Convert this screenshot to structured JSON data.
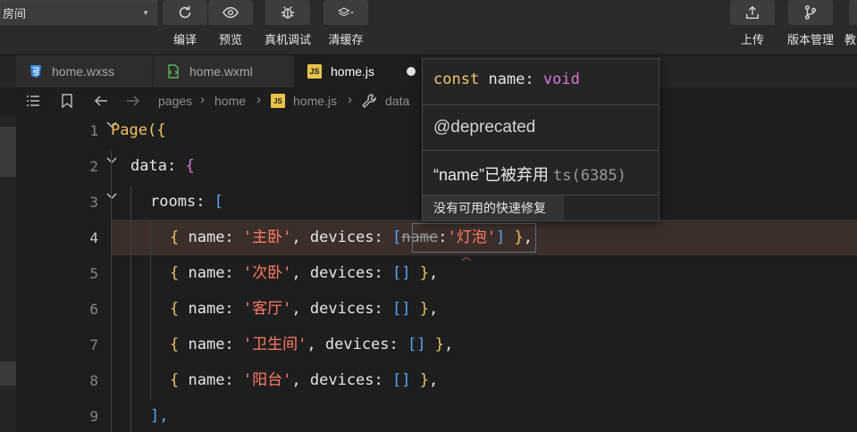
{
  "toolbar": {
    "project": "房间",
    "buttons": [
      {
        "label": "编译",
        "icon": "refresh-icon"
      },
      {
        "label": "预览",
        "icon": "eye-icon"
      },
      {
        "label": "真机调试",
        "icon": "bug-icon"
      },
      {
        "label": "清缓存",
        "icon": "layers-icon"
      }
    ],
    "right_buttons": [
      {
        "label": "上传",
        "icon": "upload-icon"
      },
      {
        "label": "版本管理",
        "icon": "branch-icon"
      },
      {
        "label": "教",
        "icon": "more-icon"
      }
    ]
  },
  "tabs": [
    {
      "name": "home.wxss",
      "icon": "css-file-icon",
      "active": false
    },
    {
      "name": "home.wxml",
      "icon": "wxml-file-icon",
      "active": false
    },
    {
      "name": "home.js",
      "icon": "js-file-icon",
      "active": true,
      "dirty": true
    }
  ],
  "breadcrumb": [
    "pages",
    "home",
    "home.js",
    "data"
  ],
  "editor": {
    "current_line": 4,
    "line_numbers": [
      "1",
      "2",
      "3",
      "4",
      "5",
      "6",
      "7",
      "8",
      "9"
    ]
  },
  "code": {
    "l1": {
      "fn": "Page",
      "paren": "({"
    },
    "l2": {
      "key": "data",
      "colon": ": ",
      "brace": "{"
    },
    "l3": {
      "key": "rooms",
      "colon": ": ",
      "bracket": "["
    },
    "rooms": [
      {
        "name": "主卧",
        "device": "灯泡",
        "deprecated_key": "name"
      },
      {
        "name": "次卧"
      },
      {
        "name": "客厅"
      },
      {
        "name": "卫生间"
      },
      {
        "name": "阳台"
      }
    ],
    "l9": "],"
  },
  "hover": {
    "signature_const": "const",
    "signature_name": "name",
    "signature_type": "void",
    "deprecated": "@deprecated",
    "message": "“name”已被弃用",
    "code": "ts(6385)",
    "quick_fix": "没有可用的快速修复"
  }
}
